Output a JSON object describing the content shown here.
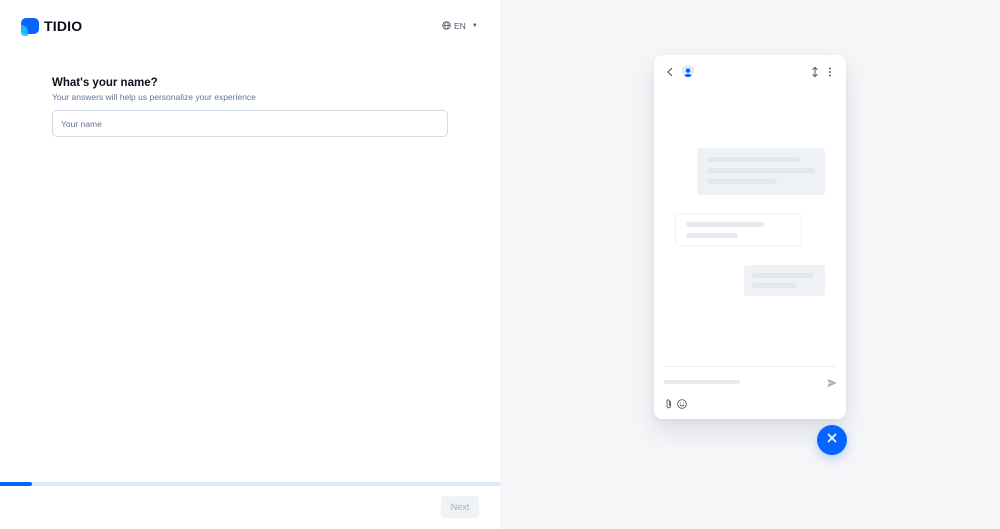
{
  "brand": {
    "name": "TIDIO",
    "color": "#0566ff"
  },
  "language": {
    "selected": "EN",
    "icon": "globe-icon"
  },
  "form": {
    "title": "What's your name?",
    "subtitle": "Your answers will help us personalize your experience",
    "name_input": {
      "placeholder": "Your name",
      "value": ""
    }
  },
  "progress": {
    "fraction": 0.064
  },
  "footer": {
    "next_label": "Next"
  },
  "widget_preview": {
    "icons": [
      "back-icon",
      "avatar-icon",
      "expand-icon",
      "more-icon",
      "send-icon",
      "attachment-icon",
      "emoji-icon",
      "close-icon"
    ]
  }
}
